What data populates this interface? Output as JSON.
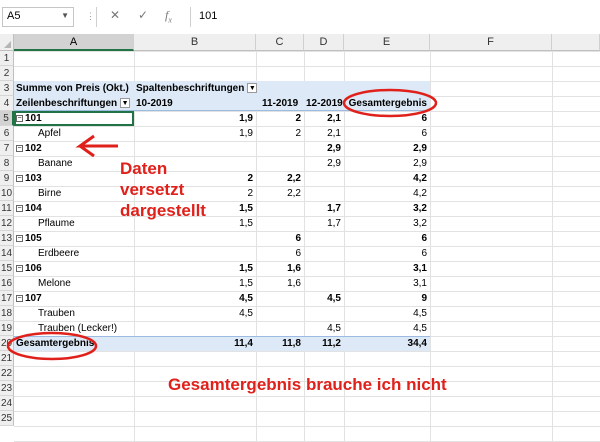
{
  "formula_bar": {
    "name_box": "A5",
    "formula_value": "101",
    "icons": [
      "cancel-icon",
      "enter-icon",
      "function-icon"
    ]
  },
  "columns": [
    "A",
    "B",
    "C",
    "D",
    "E",
    "F"
  ],
  "rows": [
    "1",
    "2",
    "3",
    "4",
    "5",
    "6",
    "7",
    "8",
    "9",
    "10",
    "11",
    "12",
    "13",
    "14",
    "15",
    "16",
    "17",
    "18",
    "19",
    "20",
    "21",
    "22",
    "23",
    "24",
    "25"
  ],
  "pivot": {
    "header": {
      "values_label": "Summe von Preis (Okt.)",
      "col_labels_title": "Spaltenbeschriftungen",
      "row_labels_title": "Zeilenbeschriftungen",
      "periods": [
        "10-2019",
        "11-2019",
        "12-2019"
      ],
      "grand_total_label": "Gesamtergebnis"
    },
    "rows": [
      {
        "label": "101",
        "group": true,
        "b": "1,9",
        "c": "2",
        "d": "2,1",
        "e": "6"
      },
      {
        "label": "Apfel",
        "group": false,
        "b": "1,9",
        "c": "2",
        "d": "2,1",
        "e": "6"
      },
      {
        "label": "102",
        "group": true,
        "b": "",
        "c": "",
        "d": "2,9",
        "e": "2,9"
      },
      {
        "label": "Banane",
        "group": false,
        "b": "",
        "c": "",
        "d": "2,9",
        "e": "2,9"
      },
      {
        "label": "103",
        "group": true,
        "b": "2",
        "c": "2,2",
        "d": "",
        "e": "4,2"
      },
      {
        "label": "Birne",
        "group": false,
        "b": "2",
        "c": "2,2",
        "d": "",
        "e": "4,2"
      },
      {
        "label": "104",
        "group": true,
        "b": "1,5",
        "c": "",
        "d": "1,7",
        "e": "3,2"
      },
      {
        "label": "Pflaume",
        "group": false,
        "b": "1,5",
        "c": "",
        "d": "1,7",
        "e": "3,2"
      },
      {
        "label": "105",
        "group": true,
        "b": "",
        "c": "6",
        "d": "",
        "e": "6"
      },
      {
        "label": "Erdbeere",
        "group": false,
        "b": "",
        "c": "6",
        "d": "",
        "e": "6"
      },
      {
        "label": "106",
        "group": true,
        "b": "1,5",
        "c": "1,6",
        "d": "",
        "e": "3,1"
      },
      {
        "label": "Melone",
        "group": false,
        "b": "1,5",
        "c": "1,6",
        "d": "",
        "e": "3,1"
      },
      {
        "label": "107",
        "group": true,
        "b": "4,5",
        "c": "",
        "d": "4,5",
        "e": "9"
      },
      {
        "label": "Trauben",
        "group": false,
        "b": "4,5",
        "c": "",
        "d": "",
        "e": "4,5"
      },
      {
        "label": "Trauben (Lecker!)",
        "group": false,
        "b": "",
        "c": "",
        "d": "4,5",
        "e": "4,5"
      }
    ],
    "grand_total": {
      "label": "Gesamtergebnis",
      "b": "11,4",
      "c": "11,8",
      "d": "11,2",
      "e": "34,4"
    }
  },
  "annotations": {
    "arrow_note": [
      "Daten",
      "versetzt",
      "dargestellt"
    ],
    "bottom_note": "Gesamtergebnis brauche ich nicht",
    "color": "#e0201a"
  },
  "colors": {
    "pivot_header_band": "#dde9f6",
    "selection_green": "#217346"
  }
}
